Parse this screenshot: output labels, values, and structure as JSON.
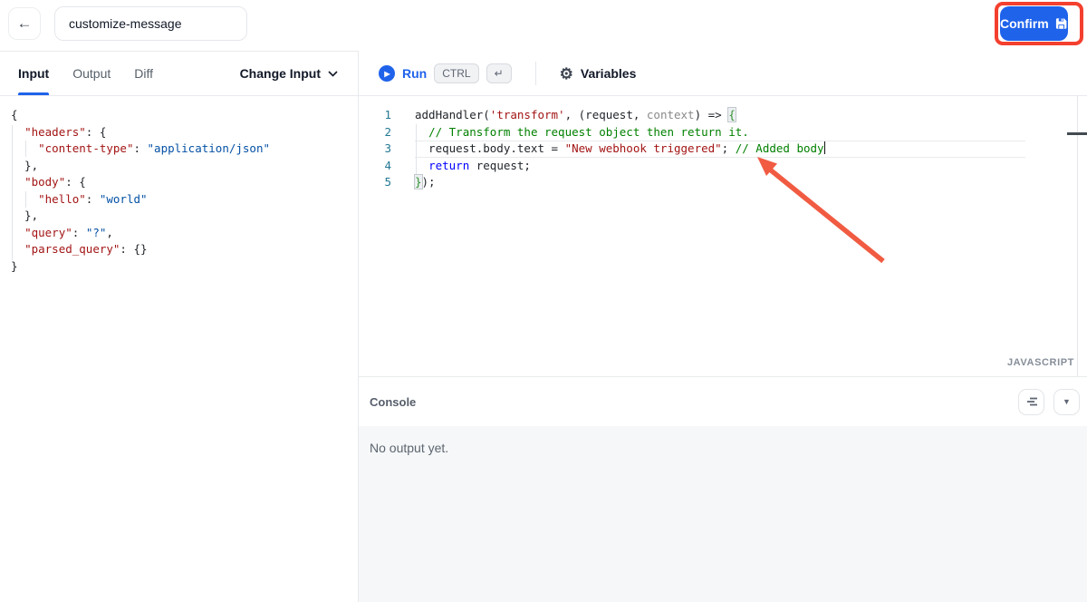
{
  "topbar": {
    "back_icon": "←",
    "name_field_value": "customize-message",
    "confirm_label": "Confirm"
  },
  "left_panel": {
    "tabs": [
      {
        "label": "Input",
        "active": true
      },
      {
        "label": "Output",
        "active": false
      },
      {
        "label": "Diff",
        "active": false
      }
    ],
    "change_input_label": "Change Input",
    "json_lines": [
      [
        [
          "p",
          "{"
        ]
      ],
      [
        [
          "p",
          "  "
        ],
        [
          "k",
          "\"headers\""
        ],
        [
          "p",
          ": {"
        ]
      ],
      [
        [
          "p",
          "    "
        ],
        [
          "k",
          "\"content-type\""
        ],
        [
          "p",
          ": "
        ],
        [
          "v",
          "\"application/json\""
        ]
      ],
      [
        [
          "p",
          "  },"
        ]
      ],
      [
        [
          "p",
          "  "
        ],
        [
          "k",
          "\"body\""
        ],
        [
          "p",
          ": {"
        ]
      ],
      [
        [
          "p",
          "    "
        ],
        [
          "k",
          "\"hello\""
        ],
        [
          "p",
          ": "
        ],
        [
          "v",
          "\"world\""
        ]
      ],
      [
        [
          "p",
          "  },"
        ]
      ],
      [
        [
          "p",
          "  "
        ],
        [
          "k",
          "\"query\""
        ],
        [
          "p",
          ": "
        ],
        [
          "v",
          "\"?\""
        ],
        [
          "p",
          ","
        ]
      ],
      [
        [
          "p",
          "  "
        ],
        [
          "k",
          "\"parsed_query\""
        ],
        [
          "p",
          ": {}"
        ]
      ],
      [
        [
          "p",
          "}"
        ]
      ]
    ]
  },
  "toolbar": {
    "run_label": "Run",
    "shortcuts": [
      "CTRL",
      "↵"
    ],
    "variables_label": "Variables"
  },
  "editor": {
    "language_label": "JAVASCRIPT",
    "current_line": 3,
    "cursor_line": 3,
    "lines": [
      [
        [
          "p",
          "addHandler("
        ],
        [
          "s",
          "'transform'"
        ],
        [
          "p",
          ", (request, "
        ],
        [
          "x",
          "context"
        ],
        [
          "p",
          ") => "
        ],
        [
          "b",
          "{"
        ]
      ],
      [
        [
          "p",
          "  "
        ],
        [
          "c",
          "// Transform the request object then return it."
        ]
      ],
      [
        [
          "p",
          "  request.body.text = "
        ],
        [
          "s",
          "\"New webhook triggered\""
        ],
        [
          "p",
          "; "
        ],
        [
          "c",
          "// Added body"
        ]
      ],
      [
        [
          "p",
          "  "
        ],
        [
          "w",
          "return"
        ],
        [
          "p",
          " request;"
        ]
      ],
      [
        [
          "b",
          "}"
        ],
        [
          "p",
          ");"
        ]
      ]
    ]
  },
  "console": {
    "title": "Console",
    "empty_message": "No output yet."
  },
  "colors": {
    "accent_blue": "#1f63eb",
    "annotation_red": "#f4402e",
    "arrow_red": "#f15b42",
    "json_key": "#a31515",
    "json_value": "#0451a5",
    "comment_green": "#008000",
    "keyword_blue": "#0000ff",
    "line_number": "#237893"
  }
}
